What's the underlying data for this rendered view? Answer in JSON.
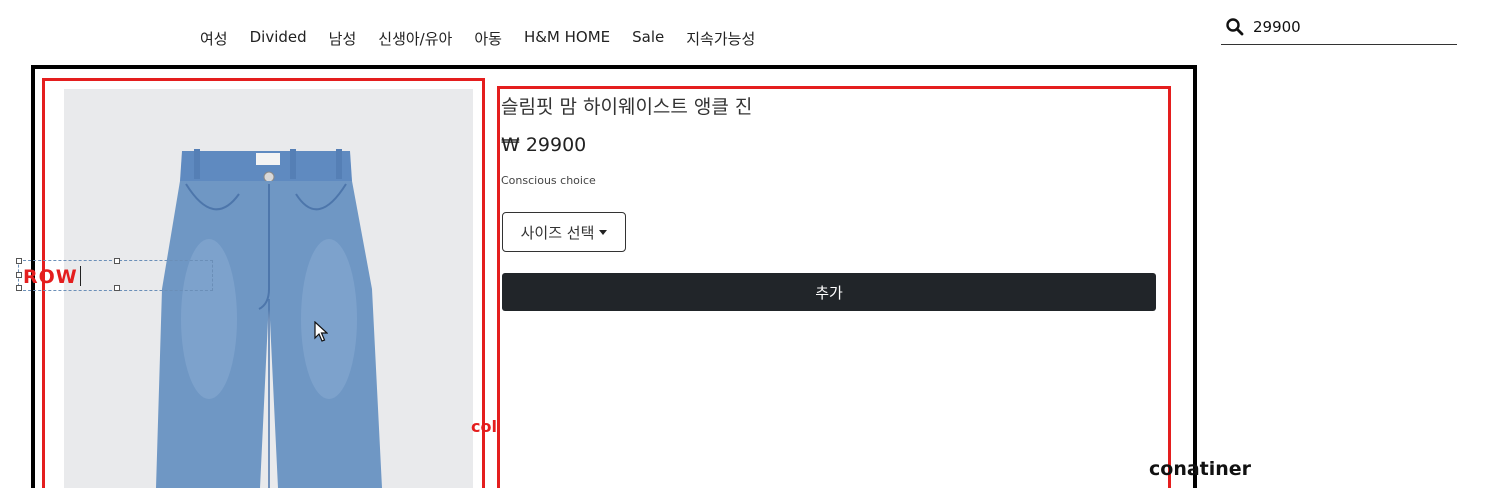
{
  "nav": {
    "items": [
      {
        "label": "여성"
      },
      {
        "label": "Divided"
      },
      {
        "label": "남성"
      },
      {
        "label": "신생아/유아"
      },
      {
        "label": "아동"
      },
      {
        "label": "H&M HOME"
      },
      {
        "label": "Sale"
      },
      {
        "label": "지속가능성"
      }
    ]
  },
  "search": {
    "value": "29900",
    "icon": "search-icon"
  },
  "product": {
    "title": "슬림핏 맘 하이웨이스트 앵클 진",
    "price": "₩ 29900",
    "tagline": "Conscious choice",
    "size_select_label": "사이즈 선택",
    "add_button_label": "추가",
    "image_icon": "jeans-image"
  },
  "annotations": {
    "row_label": "ROW",
    "col_label": "col",
    "container_label": "conatiner"
  },
  "colors": {
    "annotation_red": "#e41e1e",
    "container_border": "#000000",
    "button_dark": "#212529",
    "image_bg": "#e9eaec",
    "denim": "#6f97c4"
  }
}
